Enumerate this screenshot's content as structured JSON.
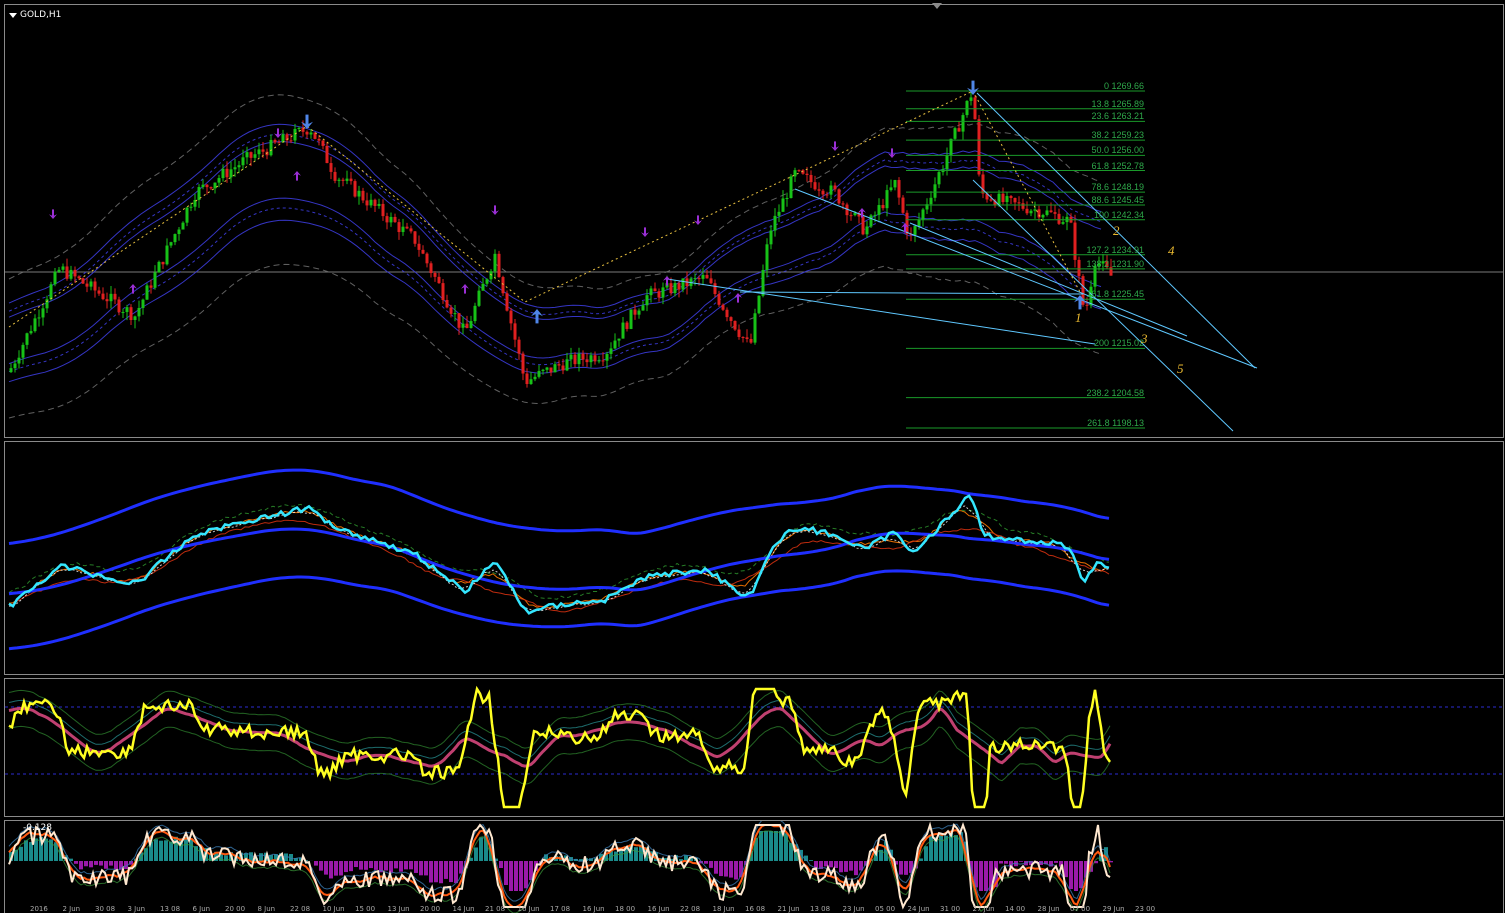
{
  "chart": {
    "symbol_label": "GOLD,H1",
    "colors": {
      "bull": "#17c217",
      "bear": "#e02020",
      "fib": "#1a9a2a",
      "trendline": "#5fc8ff",
      "band_outer": "#6a6a6a",
      "band_mid": "#3b3bd8",
      "ma_cyan": "#34e6ff",
      "ma_blue": "#1f2fff",
      "rsi_yellow": "#ffff22",
      "rsi_ma": "#c04070",
      "arrow_blue": "#4f86e8",
      "arrow_purple": "#9b2fd6",
      "wave": "#e8b830"
    }
  },
  "fib_levels": [
    {
      "text": "0 1269.66",
      "y": 1269.66
    },
    {
      "text": "13.8 1265.89",
      "y": 1265.89
    },
    {
      "text": "23.6 1263.21",
      "y": 1263.21
    },
    {
      "text": "38.2 1259.23",
      "y": 1259.23
    },
    {
      "text": "50.0 1256.00",
      "y": 1256.0
    },
    {
      "text": "61.8 1252.78",
      "y": 1252.78
    },
    {
      "text": "78.6 1248.19",
      "y": 1248.19
    },
    {
      "text": "88.6 1245.45",
      "y": 1245.45
    },
    {
      "text": "100 1242.34",
      "y": 1242.34
    },
    {
      "text": "127.2 1234.91",
      "y": 1234.91
    },
    {
      "text": "138.2 1231.90",
      "y": 1231.9
    },
    {
      "text": "161.8 1225.45",
      "y": 1225.45
    },
    {
      "text": "200 1215.02",
      "y": 1215.02
    },
    {
      "text": "238.2 1204.58",
      "y": 1204.58
    },
    {
      "text": "261.8 1198.13",
      "y": 1198.13
    }
  ],
  "wave_labels": [
    "1",
    "2",
    "3",
    "4",
    "5"
  ],
  "stoch": {
    "label": "-0.128"
  },
  "time_axis": [
    "2016",
    "2 Jun",
    "30 08",
    "3 Jun",
    "13 08",
    "6 Jun",
    "20 00",
    "8 Jun",
    "22 08",
    "10 Jun",
    "15 00",
    "13 Jun",
    "20 00",
    "14 Jun",
    "21 08",
    "16 Jun",
    "17 08",
    "16 Jun",
    "18 00",
    "16 Jun",
    "22 08",
    "18 Jun",
    "16 08",
    "21 Jun",
    "13 08",
    "23 Jun",
    "05 00",
    "24 Jun",
    "31 00",
    "27 Jun",
    "14 00",
    "28 Jun",
    "07 00",
    "29 Jun",
    "23 00"
  ]
}
